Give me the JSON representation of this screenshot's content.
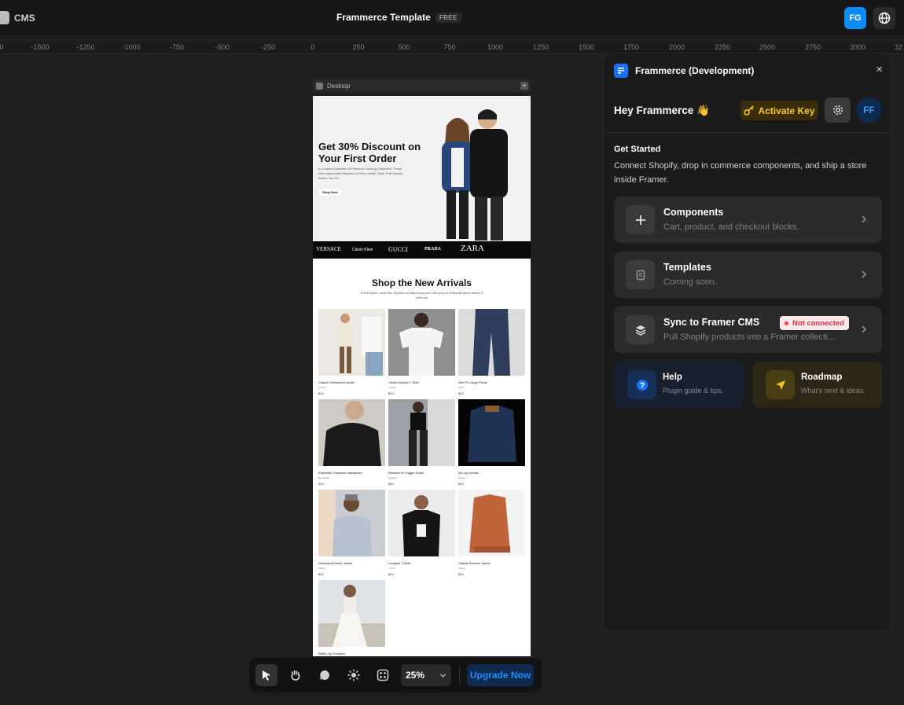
{
  "topbar": {
    "cms_label": "CMS",
    "project_title": "Frammerce Template",
    "plan_badge": "FREE",
    "user_initials": "FG"
  },
  "ruler": {
    "ticks": [
      "0",
      "-1500",
      "-1250",
      "-1000",
      "-750",
      "-500",
      "-250",
      "0",
      "250",
      "500",
      "750",
      "1000",
      "1250",
      "1500",
      "1750",
      "2000",
      "2250",
      "2500",
      "2750",
      "3000",
      "32"
    ]
  },
  "canvas": {
    "frame_label": "Desktop",
    "hero": {
      "title": "Get 30% Discount on Your First Order",
      "subtitle": "A Curated Collection of Premium Clothing Crafted for Those Who Appreciate Elegance in Every Detail. Style That Speaks Before You Do.",
      "button": "Shop Now"
    },
    "brands": [
      "VERSACE",
      "Calvin Klein",
      "GUCCI",
      "PRADA",
      "ZARA"
    ],
    "section": {
      "title": "Shop the New Arrivals",
      "subtitle": "Fresh styles, clean fits. Explore our latest drop and find your next favorite piece before it sells out"
    },
    "products": [
      {
        "name": "Classic Oversized Hoodie",
        "category": "Hoodie",
        "price": "$10"
      },
      {
        "name": "Urban Graphic T-Shirt",
        "category": "T-Shirt",
        "price": "$10"
      },
      {
        "name": "Slim Fit Cargo Pants",
        "category": "Pants",
        "price": "$10"
      },
      {
        "name": "Essential Crewneck Sweatshirt",
        "category": "Sweatshirt",
        "price": "$10"
      },
      {
        "name": "Relaxed Fit Jogger Pants",
        "category": "Joggers",
        "price": "$10"
      },
      {
        "name": "Zip-Up Hoodie",
        "category": "Hoodie",
        "price": "$10"
      },
      {
        "name": "Oversized Denim Jacket",
        "category": "Jacket",
        "price": "$10"
      },
      {
        "name": "Longline T-Shirt",
        "category": "T-Shirt",
        "price": "$10"
      },
      {
        "name": "Classic Bomber Jacket",
        "category": "Jacket",
        "price": "$10"
      },
      {
        "name": "Wide Leg Trousers",
        "category": "",
        "price": ""
      }
    ]
  },
  "panel": {
    "title": "Frammerce (Development)",
    "greeting": "Hey Frammerce 👋",
    "activate_key": "Activate Key",
    "avatar": "FF",
    "get_started_title": "Get Started",
    "get_started_desc": "Connect Shopify, drop in commerce components, and ship a store inside Framer.",
    "cards": [
      {
        "title": "Components",
        "subtitle": "Cart, product, and checkout blocks."
      },
      {
        "title": "Templates",
        "subtitle": "Coming soon."
      },
      {
        "title": "Sync to Framer CMS",
        "subtitle": "Pull Shopify products into a Framer collecti...",
        "badge": "Not connected"
      }
    ],
    "help": {
      "title": "Help",
      "subtitle": "Plugin guide & tips."
    },
    "roadmap": {
      "title": "Roadmap",
      "subtitle": "What's next & ideas."
    }
  },
  "toolbar": {
    "zoom": "25%",
    "upgrade": "Upgrade Now"
  },
  "colors": {
    "accent_blue": "#1672ff",
    "activate_yellow": "#ffc61a",
    "not_connected_red": "#e0313e"
  }
}
